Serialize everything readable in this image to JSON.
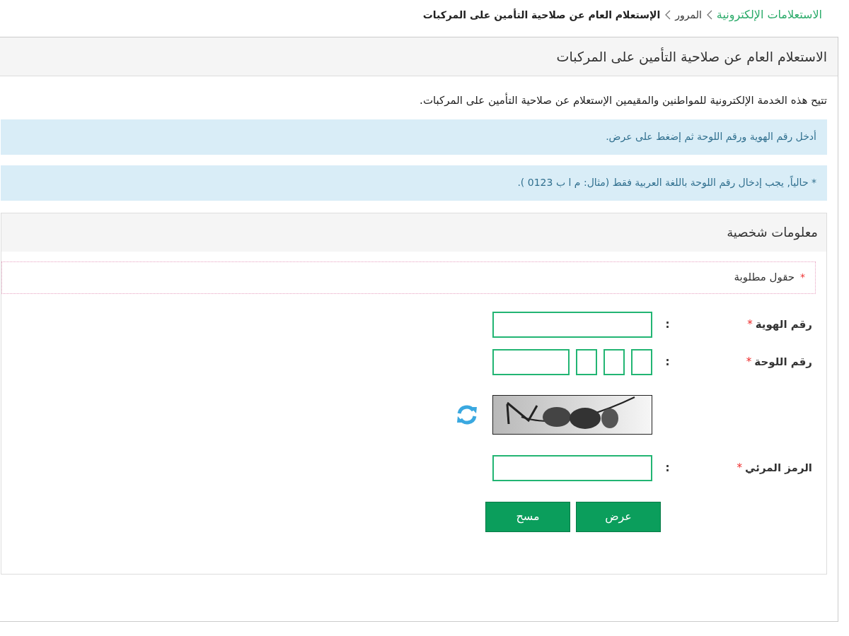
{
  "breadcrumb": [
    {
      "label": "الاستعلامات الإلكترونية",
      "kind": "link"
    },
    {
      "label": "المرور",
      "kind": "link"
    },
    {
      "label": "الإستعلام العام عن صلاحية التأمين على المركبات",
      "kind": "current"
    }
  ],
  "panel": {
    "title": "الاستعلام العام عن صلاحية التأمين على المركبات",
    "description": "تتيح هذه الخدمة الإلكترونية للمواطنين والمقيمين الإستعلام عن صلاحية التأمين على المركبات.",
    "notices": [
      "أدخل رقم الهوية ورقم اللوحة ثم إضغط على عرض.",
      "* حالياً, يجب إدخال رقم اللوحة باللغة العربية فقط (مثال: م ا ب 0123 )."
    ]
  },
  "form": {
    "title": "معلومات شخصية",
    "required_note": {
      "mark": "*",
      "text": "حقول مطلوبة"
    },
    "fields": [
      {
        "kind": "text",
        "label": "رقم الهوية",
        "required_mark": "*",
        "separator": ":"
      },
      {
        "kind": "plate",
        "label": "رقم اللوحة",
        "required_mark": "*",
        "separator": ":"
      },
      {
        "kind": "captcha"
      },
      {
        "kind": "text",
        "label": "الرمز المرئي",
        "required_mark": "*",
        "separator": ":"
      }
    ],
    "buttons": [
      {
        "label": "عرض"
      },
      {
        "label": "مسح"
      }
    ]
  }
}
